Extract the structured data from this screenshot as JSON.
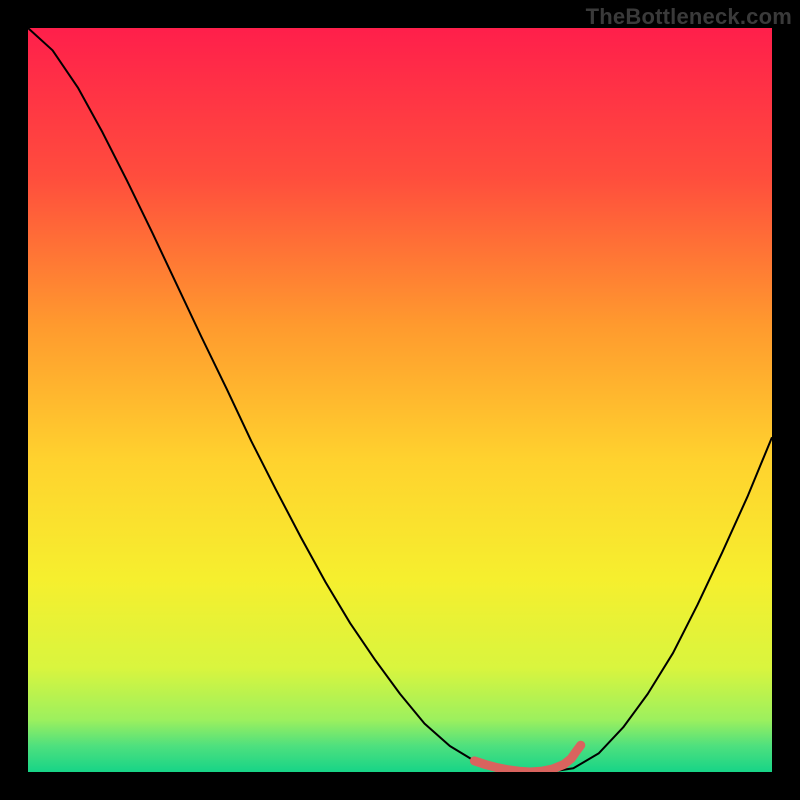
{
  "watermark": "TheBottleneck.com",
  "chart_data": {
    "type": "line",
    "title": "",
    "xlabel": "",
    "ylabel": "",
    "xlim": [
      0,
      100
    ],
    "ylim": [
      0,
      100
    ],
    "grid": false,
    "legend": false,
    "background_gradient_stops": [
      {
        "offset": 0.0,
        "color": "#ff1f4b"
      },
      {
        "offset": 0.2,
        "color": "#ff4d3d"
      },
      {
        "offset": 0.4,
        "color": "#ff9a2e"
      },
      {
        "offset": 0.58,
        "color": "#ffd22e"
      },
      {
        "offset": 0.74,
        "color": "#f6ef2e"
      },
      {
        "offset": 0.86,
        "color": "#d9f53e"
      },
      {
        "offset": 0.93,
        "color": "#9cf05e"
      },
      {
        "offset": 0.965,
        "color": "#4ee07e"
      },
      {
        "offset": 1.0,
        "color": "#17d487"
      }
    ],
    "series": [
      {
        "name": "bottleneck-curve",
        "stroke": "#000000",
        "stroke_width": 2,
        "x": [
          0.0,
          3.3,
          6.7,
          10.0,
          13.3,
          16.7,
          20.0,
          23.3,
          26.7,
          30.0,
          33.3,
          36.7,
          40.0,
          43.3,
          46.7,
          50.0,
          53.3,
          56.7,
          60.0,
          63.3,
          66.7,
          70.0,
          73.3,
          76.7,
          80.0,
          83.3,
          86.7,
          90.0,
          93.3,
          96.7,
          100.0
        ],
        "y": [
          100.0,
          97.0,
          92.0,
          86.0,
          79.5,
          72.5,
          65.5,
          58.5,
          51.5,
          44.5,
          38.0,
          31.5,
          25.5,
          20.0,
          15.0,
          10.5,
          6.5,
          3.5,
          1.5,
          0.5,
          0.0,
          0.0,
          0.5,
          2.5,
          6.0,
          10.5,
          16.0,
          22.5,
          29.5,
          37.0,
          45.0
        ]
      }
    ],
    "highlight": {
      "name": "optimal-range",
      "stroke": "#d9635e",
      "stroke_width": 9,
      "linecap": "round",
      "x": [
        60.0,
        61.5,
        63.0,
        64.5,
        66.0,
        67.5,
        69.0,
        70.5,
        72.0,
        73.0,
        73.7,
        74.3
      ],
      "y": [
        1.5,
        1.0,
        0.6,
        0.3,
        0.1,
        0.0,
        0.1,
        0.4,
        1.0,
        1.8,
        2.8,
        3.6
      ]
    }
  }
}
